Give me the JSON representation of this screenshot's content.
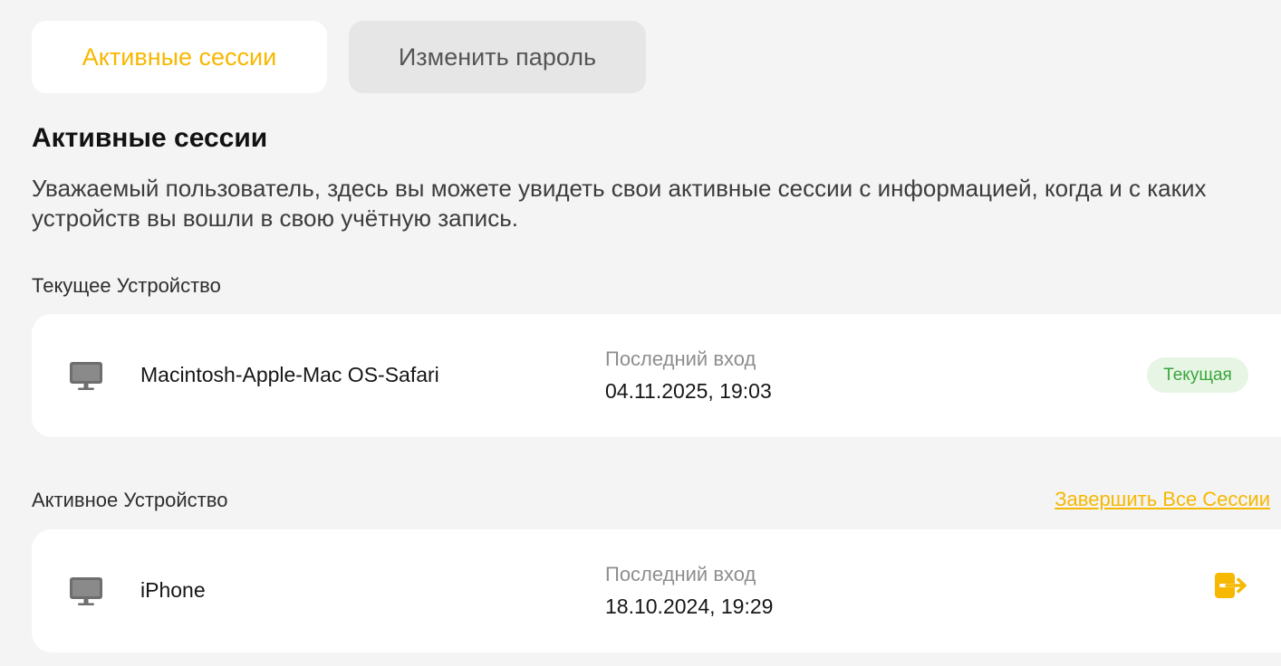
{
  "tabs": {
    "active_sessions": "Активные сессии",
    "change_password": "Изменить пароль"
  },
  "section": {
    "title": "Активные сессии",
    "description": "Уважаемый пользователь, здесь вы можете увидеть свои активные сессии с информацией, когда и с каких устройств вы вошли в свою учётную запись."
  },
  "current_device": {
    "heading": "Текущее Устройство",
    "icon": "monitor-icon",
    "name": "Macintosh-Apple-Mac OS-Safari",
    "last_login_label": "Последний вход",
    "last_login": "04.11.2025, 19:03",
    "status_badge": "Текущая"
  },
  "active_devices": {
    "heading": "Активное Устройство",
    "end_all_link": "Завершить Все Сессии",
    "items": [
      {
        "icon": "monitor-icon",
        "name": "iPhone",
        "last_login_label": "Последний вход",
        "last_login": "18.10.2024, 19:29",
        "action_icon": "logout-icon"
      }
    ]
  },
  "colors": {
    "accent": "#f6b800",
    "badge_bg": "#e7f5e5",
    "badge_text": "#3aa53a",
    "page_bg": "#f4f4f4"
  }
}
